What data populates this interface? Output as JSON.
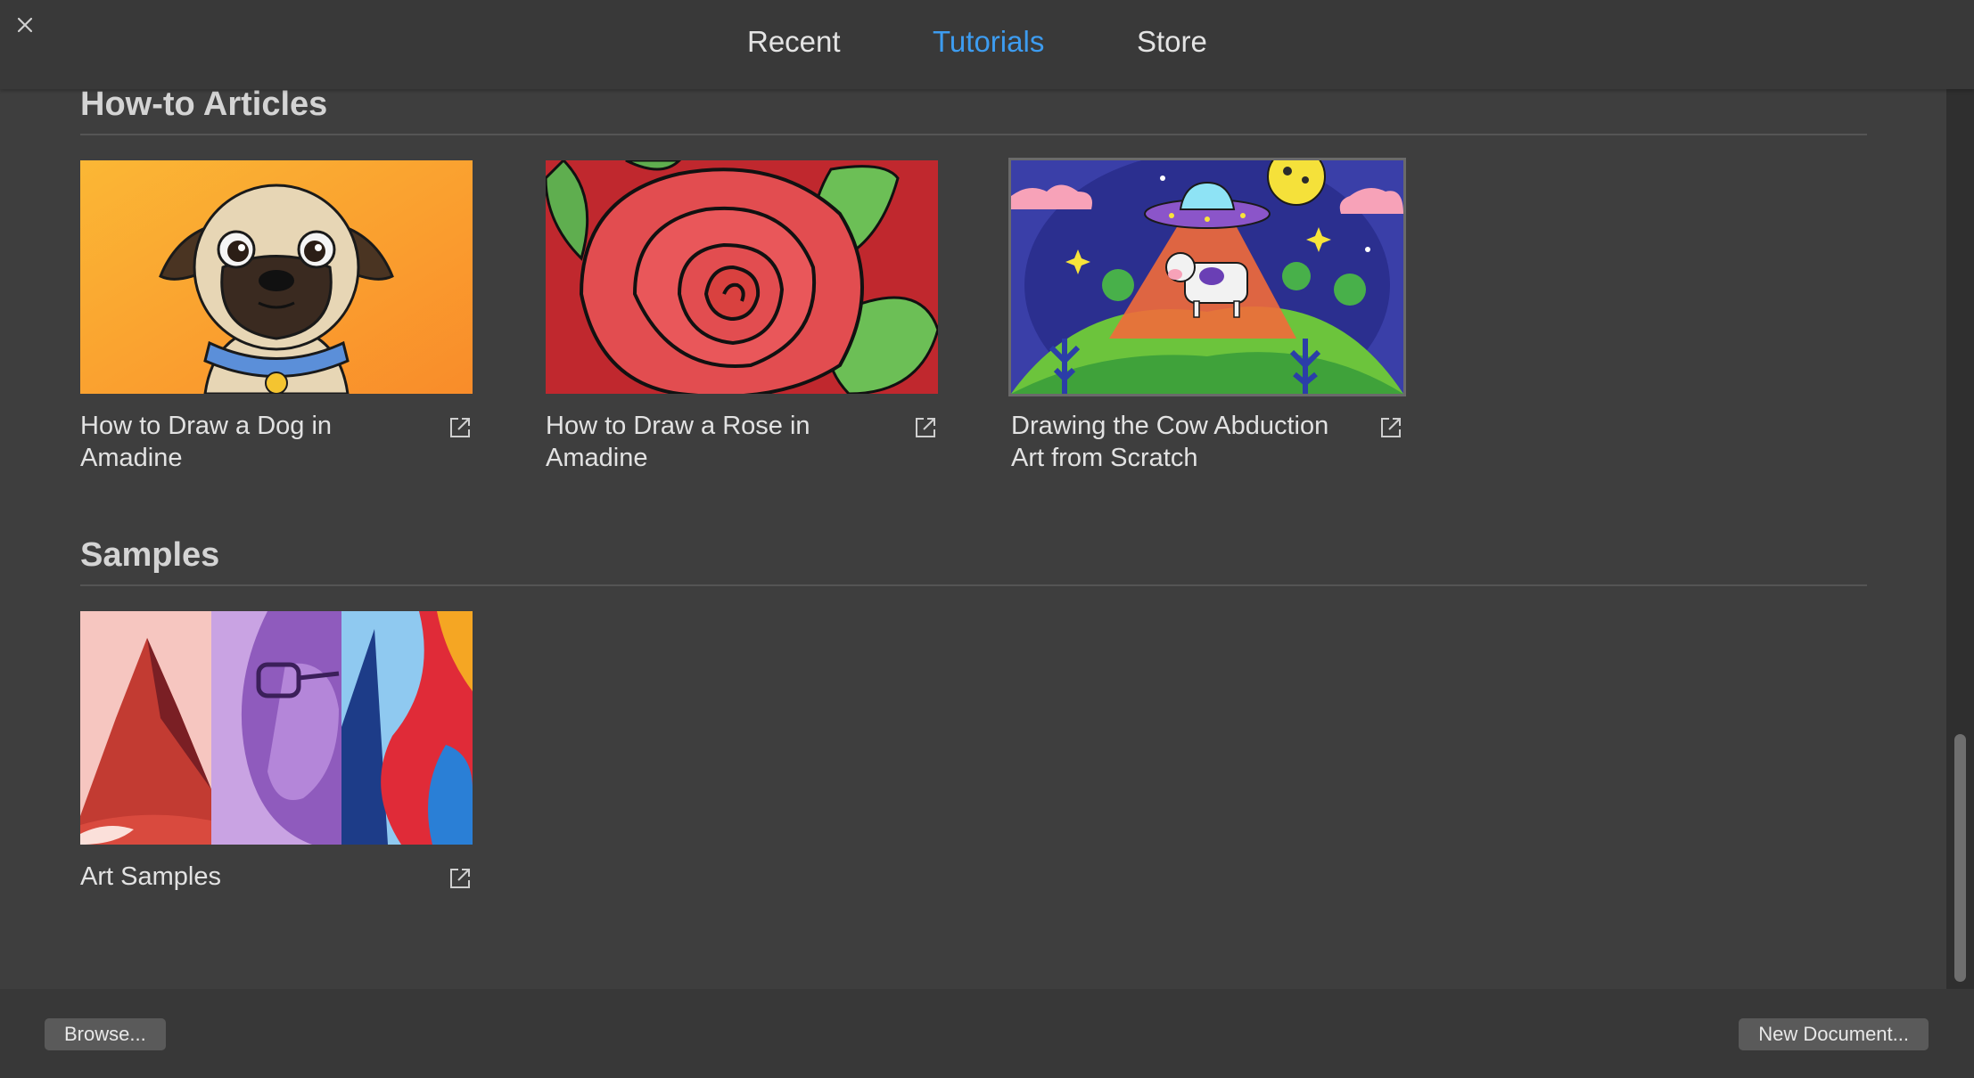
{
  "header": {
    "close_icon": "close-icon",
    "tabs": [
      {
        "label": "Recent",
        "active": false
      },
      {
        "label": "Tutorials",
        "active": true
      },
      {
        "label": "Store",
        "active": false
      }
    ],
    "active_color": "#3d9cf0"
  },
  "sections": {
    "howto": {
      "title": "How-to Articles",
      "cards": [
        {
          "title": "How to Draw a Dog in Amadine",
          "thumb": "pug-illustration",
          "icon": "external-link-icon"
        },
        {
          "title": "How to Draw a Rose in Amadine",
          "thumb": "rose-illustration",
          "icon": "external-link-icon"
        },
        {
          "title": "Drawing the Cow Abduction Art from Scratch",
          "thumb": "cow-abduction-illustration",
          "icon": "external-link-icon",
          "selected": true
        }
      ]
    },
    "samples": {
      "title": "Samples",
      "cards": [
        {
          "title": "Art Samples",
          "thumb": "art-samples-collage",
          "icon": "external-link-icon"
        }
      ]
    }
  },
  "footer": {
    "browse_label": "Browse...",
    "new_document_label": "New Document..."
  }
}
